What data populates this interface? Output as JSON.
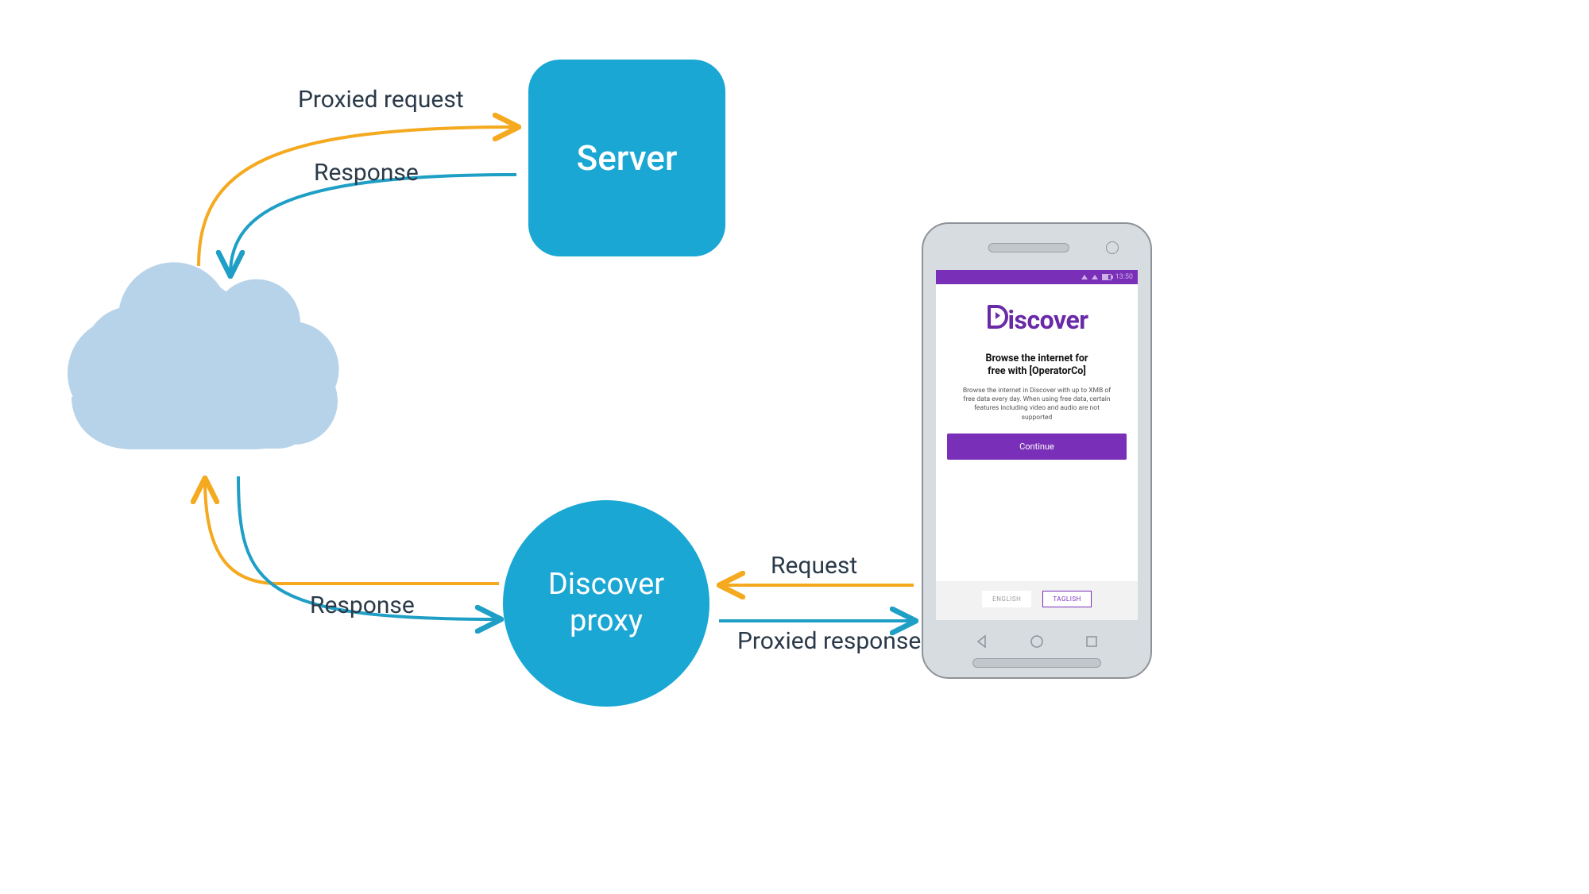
{
  "nodes": {
    "server": {
      "label": "Server"
    },
    "proxy": {
      "label": "Discover\nproxy"
    },
    "cloud": {
      "name": "internet-cloud"
    }
  },
  "flows": {
    "cloud_to_server": {
      "label": "Proxied request"
    },
    "server_to_cloud": {
      "label": "Response"
    },
    "cloud_to_proxy": {
      "label": "Response"
    },
    "proxy_to_phone": {
      "label": "Proxied response"
    },
    "phone_to_proxy": {
      "label": "Request"
    }
  },
  "phone": {
    "status_time": "13:50",
    "logo_text": "Discover",
    "title": "Browse the internet for\nfree with [OperatorCo]",
    "description": "Browse the internet in Discover with up to XMB of\nfree data every day. When using free data, certain\nfeatures including video and audio are not\nsupported",
    "continue_label": "Continue",
    "lang_options": [
      "ENGLISH",
      "TAGLISH"
    ],
    "lang_selected": 1
  },
  "colors": {
    "node_blue": "#1aa7d4",
    "cloud_blue": "#b7d3ea",
    "arrow_orange": "#f4a91f",
    "arrow_blue": "#1f9fc6",
    "text_dark": "#2b3a49",
    "purple": "#7a2fb8"
  }
}
